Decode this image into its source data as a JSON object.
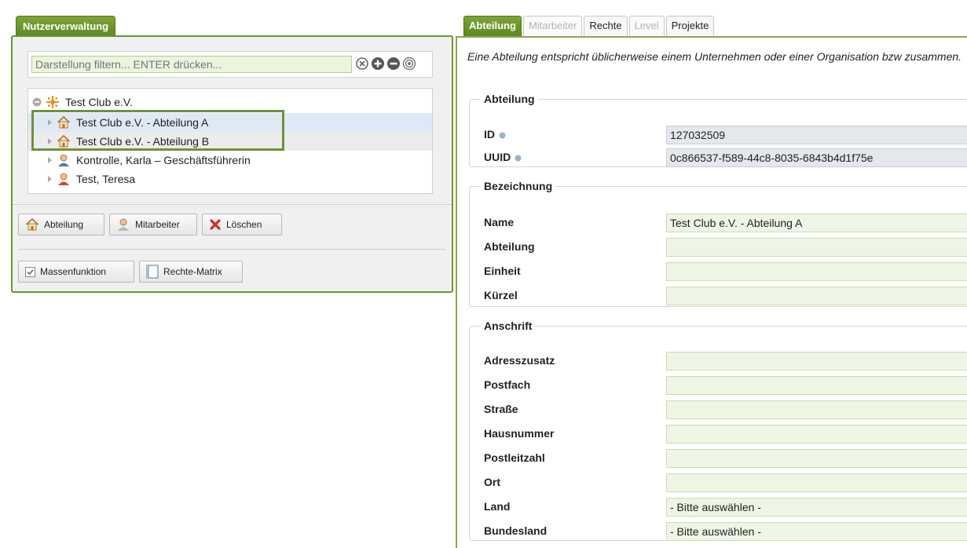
{
  "left": {
    "tab_label": "Nutzerverwaltung",
    "filter_placeholder": "Darstellung filtern... ENTER drücken...",
    "tree": [
      {
        "label": "Test Club e.V.",
        "icon": "org-icon"
      },
      {
        "label": "Test Club e.V. - Abteilung A",
        "icon": "house-icon"
      },
      {
        "label": "Test Club e.V. - Abteilung B",
        "icon": "house-icon"
      },
      {
        "label": "Kontrolle, Karla – Geschäftsführerin",
        "icon": "user-icon"
      },
      {
        "label": "Test, Teresa",
        "icon": "user-icon"
      }
    ],
    "buttons": {
      "abteilung": "Abteilung",
      "mitarbeiter": "Mitarbeiter",
      "loeschen": "Löschen",
      "massenfunktion": "Massenfunktion",
      "rechte_matrix": "Rechte-Matrix"
    }
  },
  "right": {
    "tabs": [
      "Abteilung",
      "Mitarbeiter",
      "Rechte",
      "Level",
      "Projekte"
    ],
    "active_tab": "Abteilung",
    "description": "Eine Abteilung entspricht üblicherweise einem Unternehmen oder einer Organisation bzw zusammen.",
    "abteilung_group": {
      "legend": "Abteilung",
      "id_label": "ID",
      "id_value": "127032509",
      "uuid_label": "UUID",
      "uuid_value": "0c866537-f589-44c8-8035-6843b4d1f75e"
    },
    "bezeichnung_group": {
      "legend": "Bezeichnung",
      "name_label": "Name",
      "name_value": "Test Club e.V. - Abteilung A",
      "abteilung_label": "Abteilung",
      "abteilung_value": "",
      "einheit_label": "Einheit",
      "einheit_value": "",
      "kuerzel_label": "Kürzel",
      "kuerzel_value": ""
    },
    "anschrift_group": {
      "legend": "Anschrift",
      "adresszusatz_label": "Adresszusatz",
      "postfach_label": "Postfach",
      "strasse_label": "Straße",
      "hausnummer_label": "Hausnummer",
      "postleitzahl_label": "Postleitzahl",
      "ort_label": "Ort",
      "land_label": "Land",
      "land_value": "- Bitte auswählen -",
      "bundesland_label": "Bundesland",
      "bundesland_value": "- Bitte auswählen -"
    }
  },
  "colors": {
    "accent_green": "#6a9432",
    "input_green_bg": "#eef5e4",
    "readonly_bg": "#e4e7ec",
    "selection_blue": "#dfe9f6"
  }
}
